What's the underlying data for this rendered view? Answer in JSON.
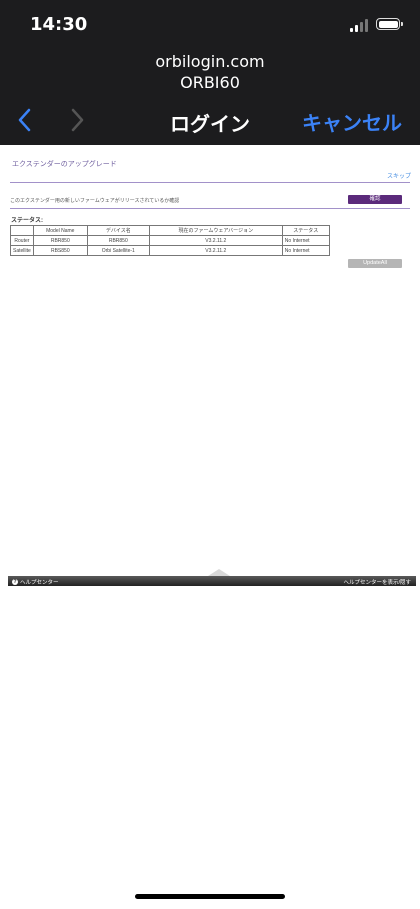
{
  "status_bar": {
    "time": "14:30"
  },
  "browser": {
    "host": "orbilogin.com",
    "device": "ORBI60",
    "title": "ログイン",
    "cancel_label": "キャンセル"
  },
  "page": {
    "title": "エクステンダーのアップグレード",
    "skip_label": "スキップ",
    "description": "このエクステンダー用の新しいファームウェアがリリースされているか確認",
    "confirm_label": "確認",
    "status_label": "ステータス:",
    "table": {
      "headers": [
        "",
        "Model Name",
        "デバイス名",
        "現在のファームウェアバージョン",
        "ステータス"
      ],
      "rows": [
        [
          "Router",
          "RBR850",
          "RBR850",
          "V3.2.11.2",
          "No Internet"
        ],
        [
          "Satellite",
          "RBS850",
          "Orbi Satellite-1",
          "V3.2.11.2",
          "No Internet"
        ]
      ]
    },
    "update_all_label": "UpdateAll"
  },
  "helpbar": {
    "left_label": "ヘルプセンター",
    "right_label": "ヘルプセンターを表示/隠す"
  },
  "icons": {
    "back": "chevron-left-icon",
    "forward": "chevron-right-icon",
    "help": "question-circle-icon"
  },
  "colors": {
    "chrome_bg": "#1c1c1e",
    "accent_blue": "#3b82f6",
    "brand_purple": "#5b2a7b"
  }
}
